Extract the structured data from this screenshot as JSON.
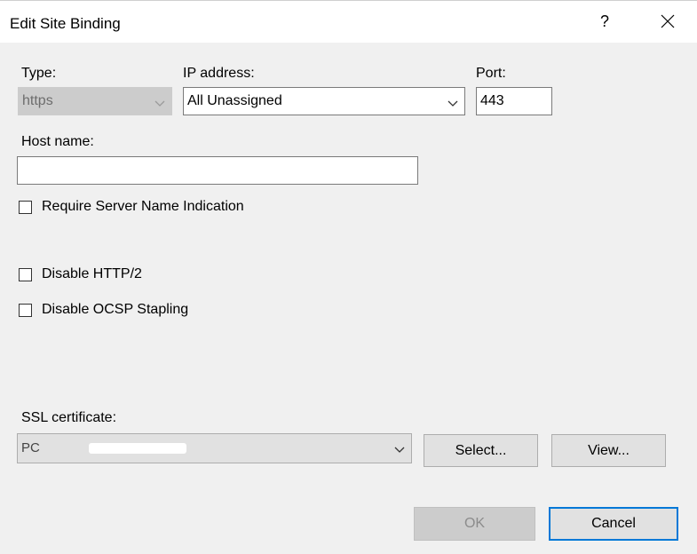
{
  "window": {
    "title": "Edit Site Binding",
    "help_glyph": "?",
    "close_icon": "close-icon"
  },
  "binding": {
    "type_label": "Type:",
    "type_value": "https",
    "ip_label": "IP address:",
    "ip_value": "All Unassigned",
    "port_label": "Port:",
    "port_value": "443",
    "host_label": "Host name:",
    "host_value": ""
  },
  "options": {
    "require_sni_label": "Require Server Name Indication",
    "require_sni_checked": false,
    "disable_http2_label": "Disable HTTP/2",
    "disable_http2_checked": false,
    "disable_ocsp_label": "Disable OCSP Stapling",
    "disable_ocsp_checked": false
  },
  "ssl": {
    "label": "SSL certificate:",
    "value_visible": "PC",
    "select_button": "Select...",
    "view_button": "View..."
  },
  "footer": {
    "ok_button": "OK",
    "cancel_button": "Cancel"
  },
  "colors": {
    "dialog_bg": "#f0f0f0",
    "titlebar_bg": "#ffffff",
    "accent": "#0078d7",
    "disabled_bg": "#cccccc"
  }
}
